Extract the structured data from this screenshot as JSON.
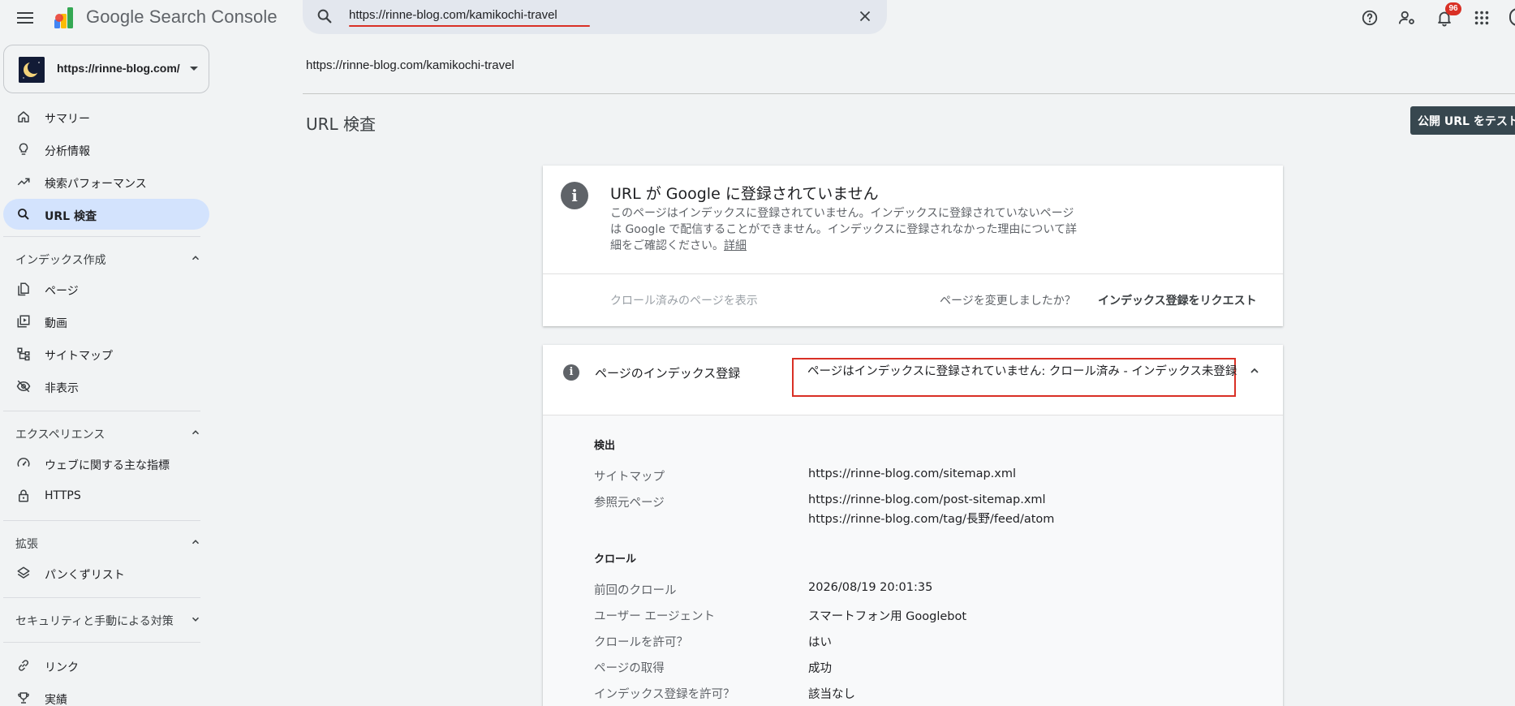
{
  "app": {
    "title": "Google Search Console"
  },
  "search": {
    "value": "https://rinne-blog.com/kamikochi-travel"
  },
  "topbar": {
    "icons": [
      "help-icon",
      "manage-users-icon",
      "notifications-icon",
      "apps-grid-icon"
    ],
    "notification_count": "96"
  },
  "property": {
    "label": "https://rinne-blog.com/"
  },
  "sidebar": {
    "items": [
      {
        "label": "サマリー",
        "icon": "home-icon"
      },
      {
        "label": "分析情報",
        "icon": "lightbulb-icon"
      },
      {
        "label": "検索パフォーマンス",
        "icon": "trending-up-icon"
      },
      {
        "label": "URL 検査",
        "icon": "search-icon",
        "active": true
      }
    ],
    "sections": [
      {
        "label": "インデックス作成",
        "expanded": true,
        "items": [
          {
            "label": "ページ",
            "icon": "pages-icon"
          },
          {
            "label": "動画",
            "icon": "video-icon"
          },
          {
            "label": "サイトマップ",
            "icon": "sitemap-icon"
          },
          {
            "label": "非表示",
            "icon": "eye-off-icon"
          }
        ]
      },
      {
        "label": "エクスペリエンス",
        "expanded": true,
        "items": [
          {
            "label": "ウェブに関する主な指標",
            "icon": "speed-icon"
          },
          {
            "label": "HTTPS",
            "icon": "lock-icon"
          }
        ]
      },
      {
        "label": "拡張",
        "expanded": true,
        "items": [
          {
            "label": "パンくずリスト",
            "icon": "layers-icon"
          }
        ]
      },
      {
        "label": "セキュリティと手動による対策",
        "expanded": false,
        "items": []
      }
    ],
    "bottom_items": [
      {
        "label": "リンク",
        "icon": "link-icon"
      },
      {
        "label": "実績",
        "icon": "trophy-icon"
      }
    ]
  },
  "main": {
    "inspected_url": "https://rinne-blog.com/kamikochi-travel",
    "page_title": "URL 検査",
    "test_live_button": "公開 URL をテスト",
    "status_card": {
      "title": "URL が Google に登録されていません",
      "description": "このページはインデックスに登録されていません。インデックスに登録されていないページは Google で配信することができません。インデックスに登録されなかった理由について詳細をご確認ください。",
      "details_link": "詳細",
      "view_crawled": "クロール済みのページを表示",
      "changed_question": "ページを変更しましたか？",
      "request_indexing": "インデックス登録をリクエスト"
    },
    "indexing_card": {
      "label": "ページのインデックス登録",
      "status": "ページはインデックスに登録されていません: クロール済み - インデックス未登録",
      "discovery": {
        "heading": "検出",
        "rows": [
          {
            "key": "サイトマップ",
            "values": [
              "https://rinne-blog.com/sitemap.xml"
            ]
          },
          {
            "key": "参照元ページ",
            "values": [
              "https://rinne-blog.com/post-sitemap.xml",
              "https://rinne-blog.com/tag/長野/feed/atom"
            ]
          }
        ]
      },
      "crawl": {
        "heading": "クロール",
        "rows": [
          {
            "key": "前回のクロール",
            "value": "2026/08/19 20:01:35"
          },
          {
            "key": "ユーザー エージェント",
            "value": "スマートフォン用 Googlebot"
          },
          {
            "key": "クロールを許可？",
            "value": "はい"
          },
          {
            "key": "ページの取得",
            "value": "成功"
          },
          {
            "key": "インデックス登録を許可？",
            "value": "該当なし"
          }
        ]
      }
    }
  },
  "colors": {
    "background": "#f1f3f4",
    "active_nav": "#d3e3fd",
    "highlight_red": "#d93025",
    "test_button": "#37474f"
  }
}
